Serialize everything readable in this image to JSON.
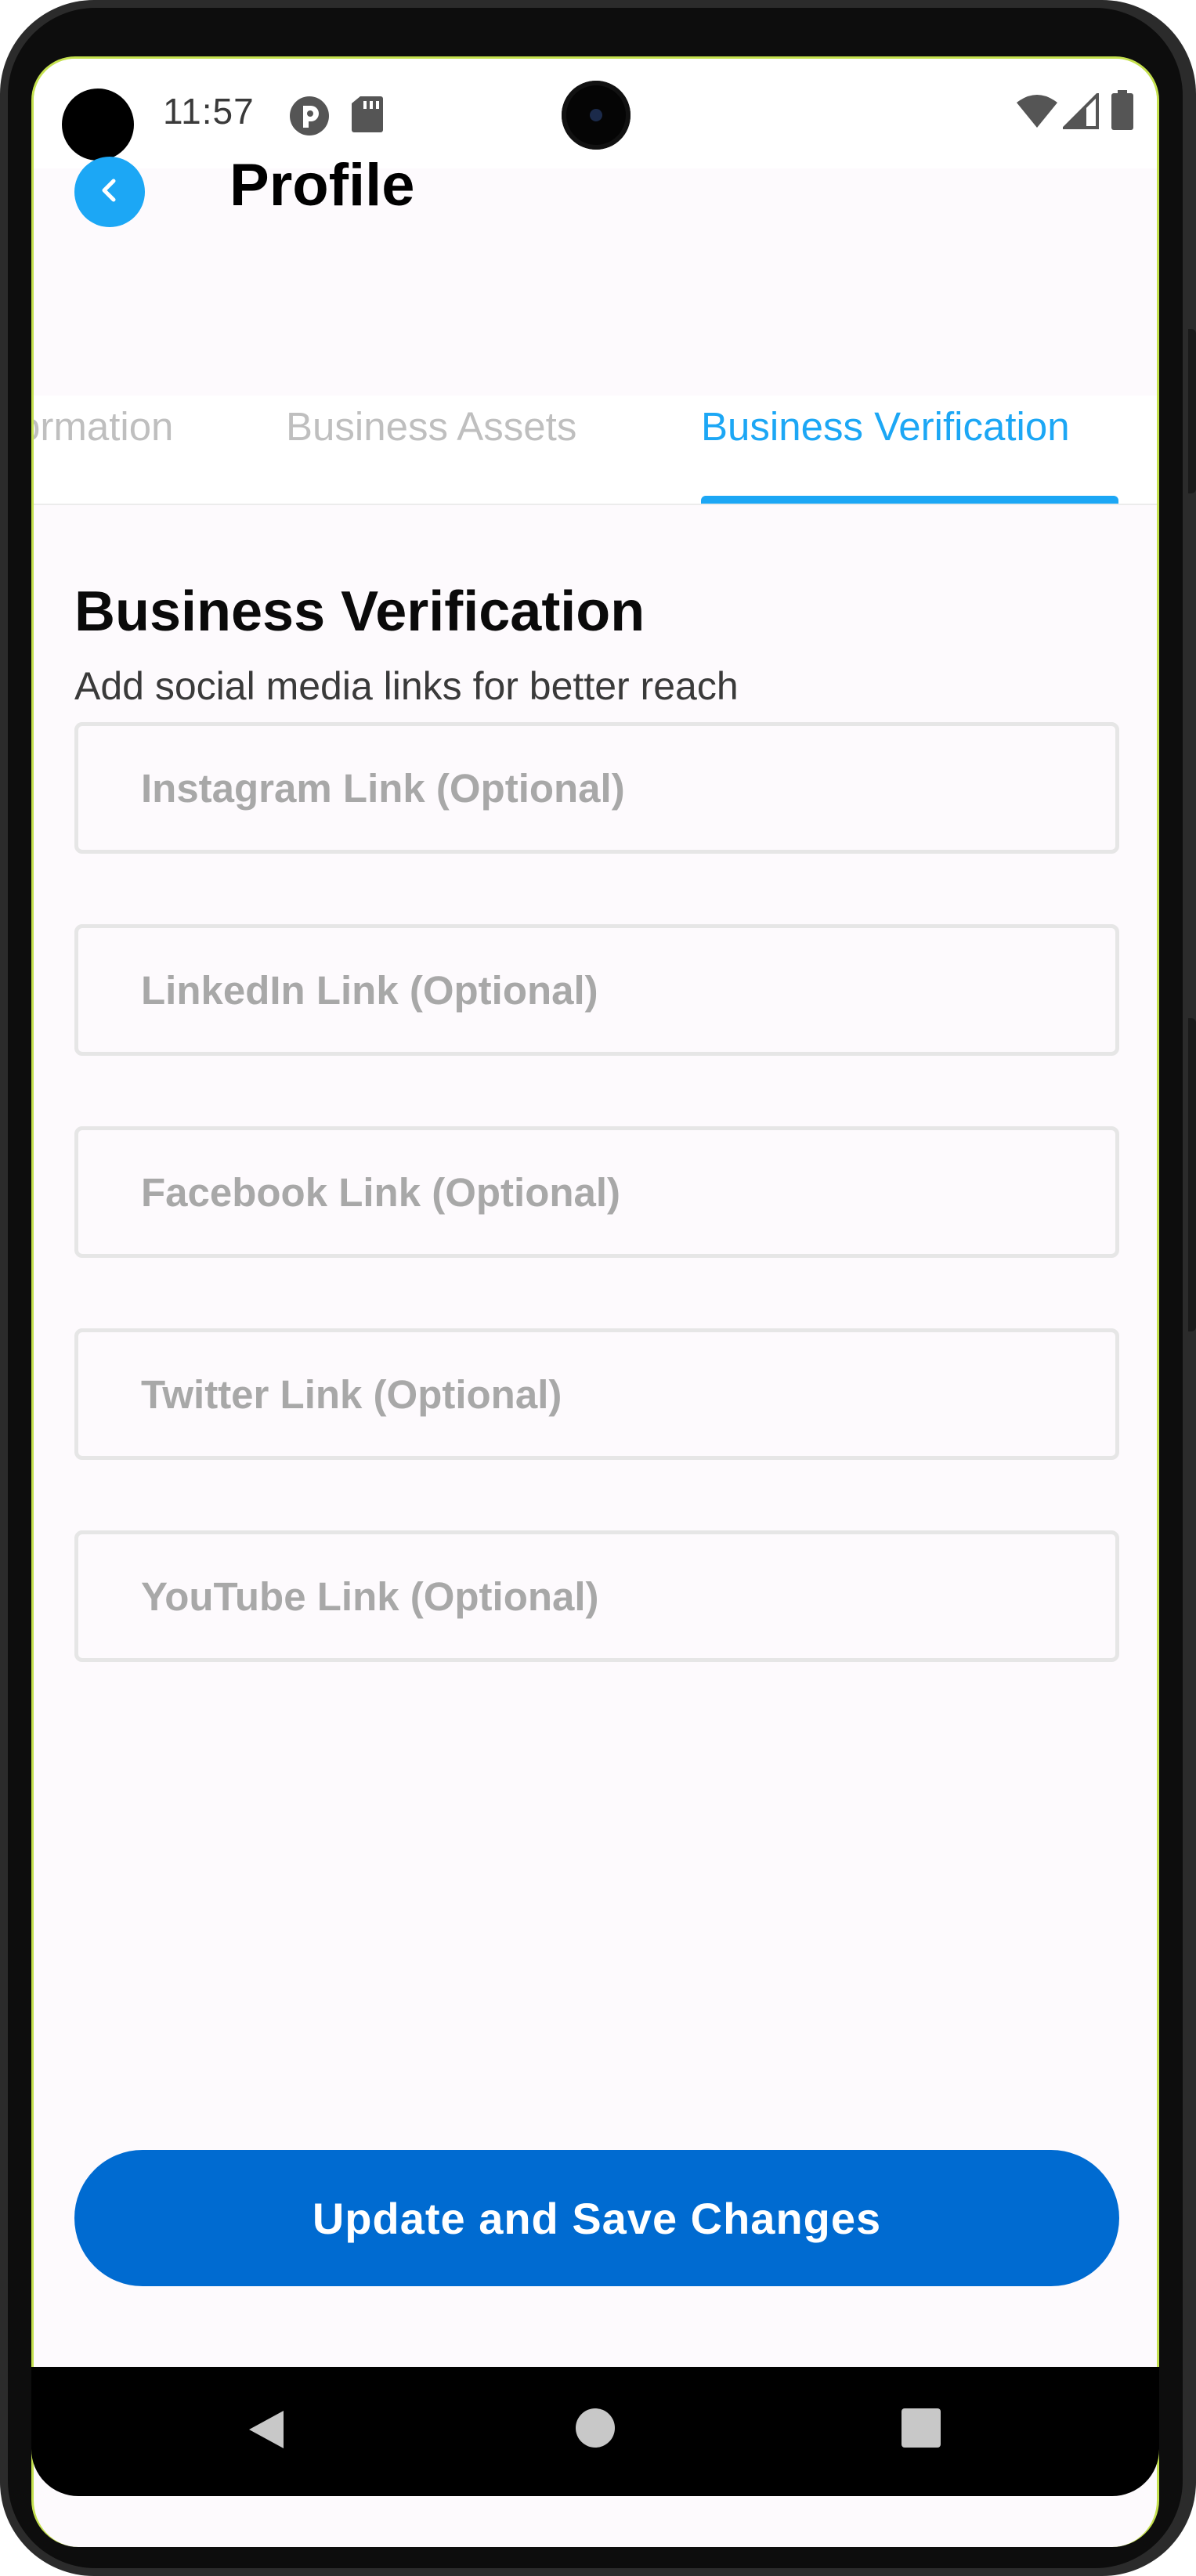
{
  "status_bar": {
    "time": "11:57",
    "icons": [
      "app-notification-icon",
      "sd-card-icon",
      "wifi-icon",
      "signal-icon",
      "battery-icon"
    ]
  },
  "header": {
    "title": "Profile",
    "back_icon": "chevron-left-icon",
    "accent_color": "#1ca7f5"
  },
  "tabs": [
    {
      "label": "ormation",
      "active": false
    },
    {
      "label": "Business Assets",
      "active": false
    },
    {
      "label": "Business Verification",
      "active": true
    }
  ],
  "section": {
    "title": "Business Verification",
    "subtitle": "Add social media links for better reach"
  },
  "fields": [
    {
      "placeholder": "Instagram Link (Optional)",
      "value": ""
    },
    {
      "placeholder": "LinkedIn Link (Optional)",
      "value": ""
    },
    {
      "placeholder": "Facebook Link (Optional)",
      "value": ""
    },
    {
      "placeholder": "Twitter Link (Optional)",
      "value": ""
    },
    {
      "placeholder": "YouTube Link (Optional)",
      "value": ""
    }
  ],
  "actions": {
    "save_label": "Update and Save Changes",
    "save_color": "#006bd1"
  },
  "nav_bar": {
    "icons": [
      "back-triangle-icon",
      "home-circle-icon",
      "recents-square-icon"
    ]
  }
}
